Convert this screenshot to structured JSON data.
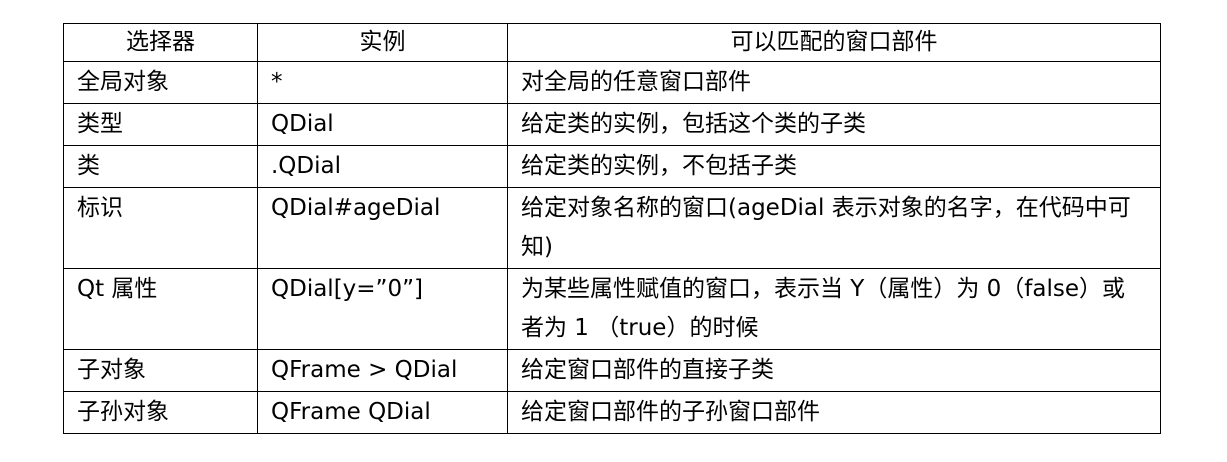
{
  "table": {
    "headers": [
      "选择器",
      "实例",
      "可以匹配的窗口部件"
    ],
    "rows": [
      [
        "全局对象",
        "*",
        "对全局的任意窗口部件"
      ],
      [
        "类型",
        "QDial",
        "给定类的实例，包括这个类的子类"
      ],
      [
        "类",
        ".QDial",
        "给定类的实例，不包括子类"
      ],
      [
        "标识",
        "QDial#ageDial",
        "给定对象名称的窗口(ageDial 表示对象的名字，在代码中可知)"
      ],
      [
        "Qt 属性",
        "QDial[y=”0”]",
        "为某些属性赋值的窗口，表示当 Y（属性）为 0（false）或者为 1 （true）的时候"
      ],
      [
        "子对象",
        "QFrame > QDial",
        "给定窗口部件的直接子类"
      ],
      [
        "子孙对象",
        "QFrame QDial",
        "给定窗口部件的子孙窗口部件"
      ]
    ]
  }
}
